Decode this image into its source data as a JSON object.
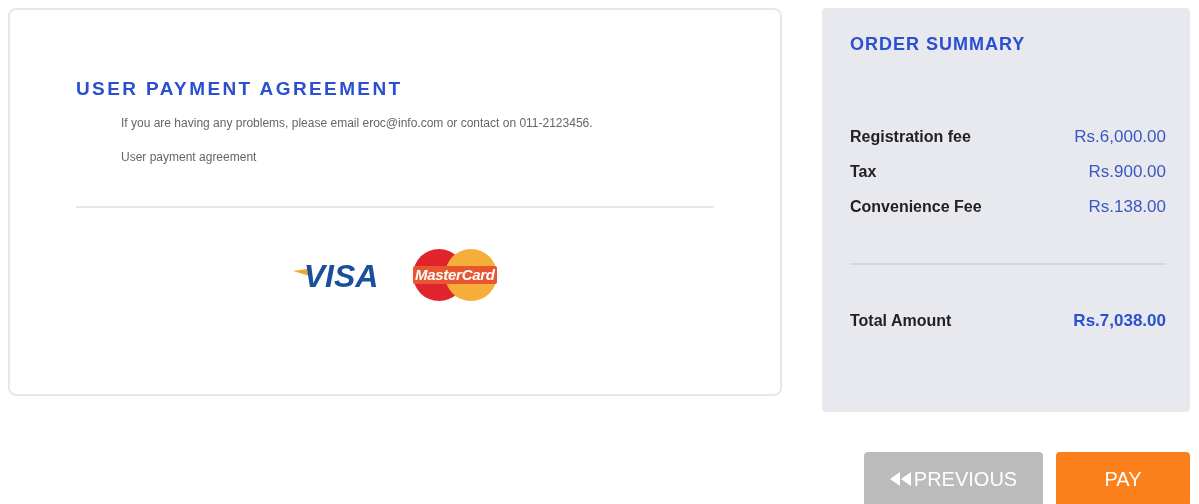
{
  "agreement": {
    "title": "USER PAYMENT AGREEMENT",
    "contact_text": "If you are having any problems, please email eroc@info.com or contact on 011-2123456.",
    "link_text": "User payment agreement",
    "card_logos": [
      {
        "kind": "visa",
        "text": "VISA"
      },
      {
        "kind": "mastercard",
        "text": "MasterCard"
      }
    ]
  },
  "order_summary": {
    "title": "ORDER SUMMARY",
    "items": [
      {
        "label": "Registration fee",
        "amount": "Rs.6,000.00"
      },
      {
        "label": "Tax",
        "amount": "Rs.900.00"
      },
      {
        "label": "Convenience Fee",
        "amount": "Rs.138.00"
      }
    ],
    "total": {
      "label": "Total Amount",
      "amount": "Rs.7,038.00"
    }
  },
  "buttons": [
    {
      "kind": "previous",
      "label": "PREVIOUS",
      "disabled": true
    },
    {
      "kind": "pay",
      "label": "PAY",
      "disabled": false
    }
  ]
}
